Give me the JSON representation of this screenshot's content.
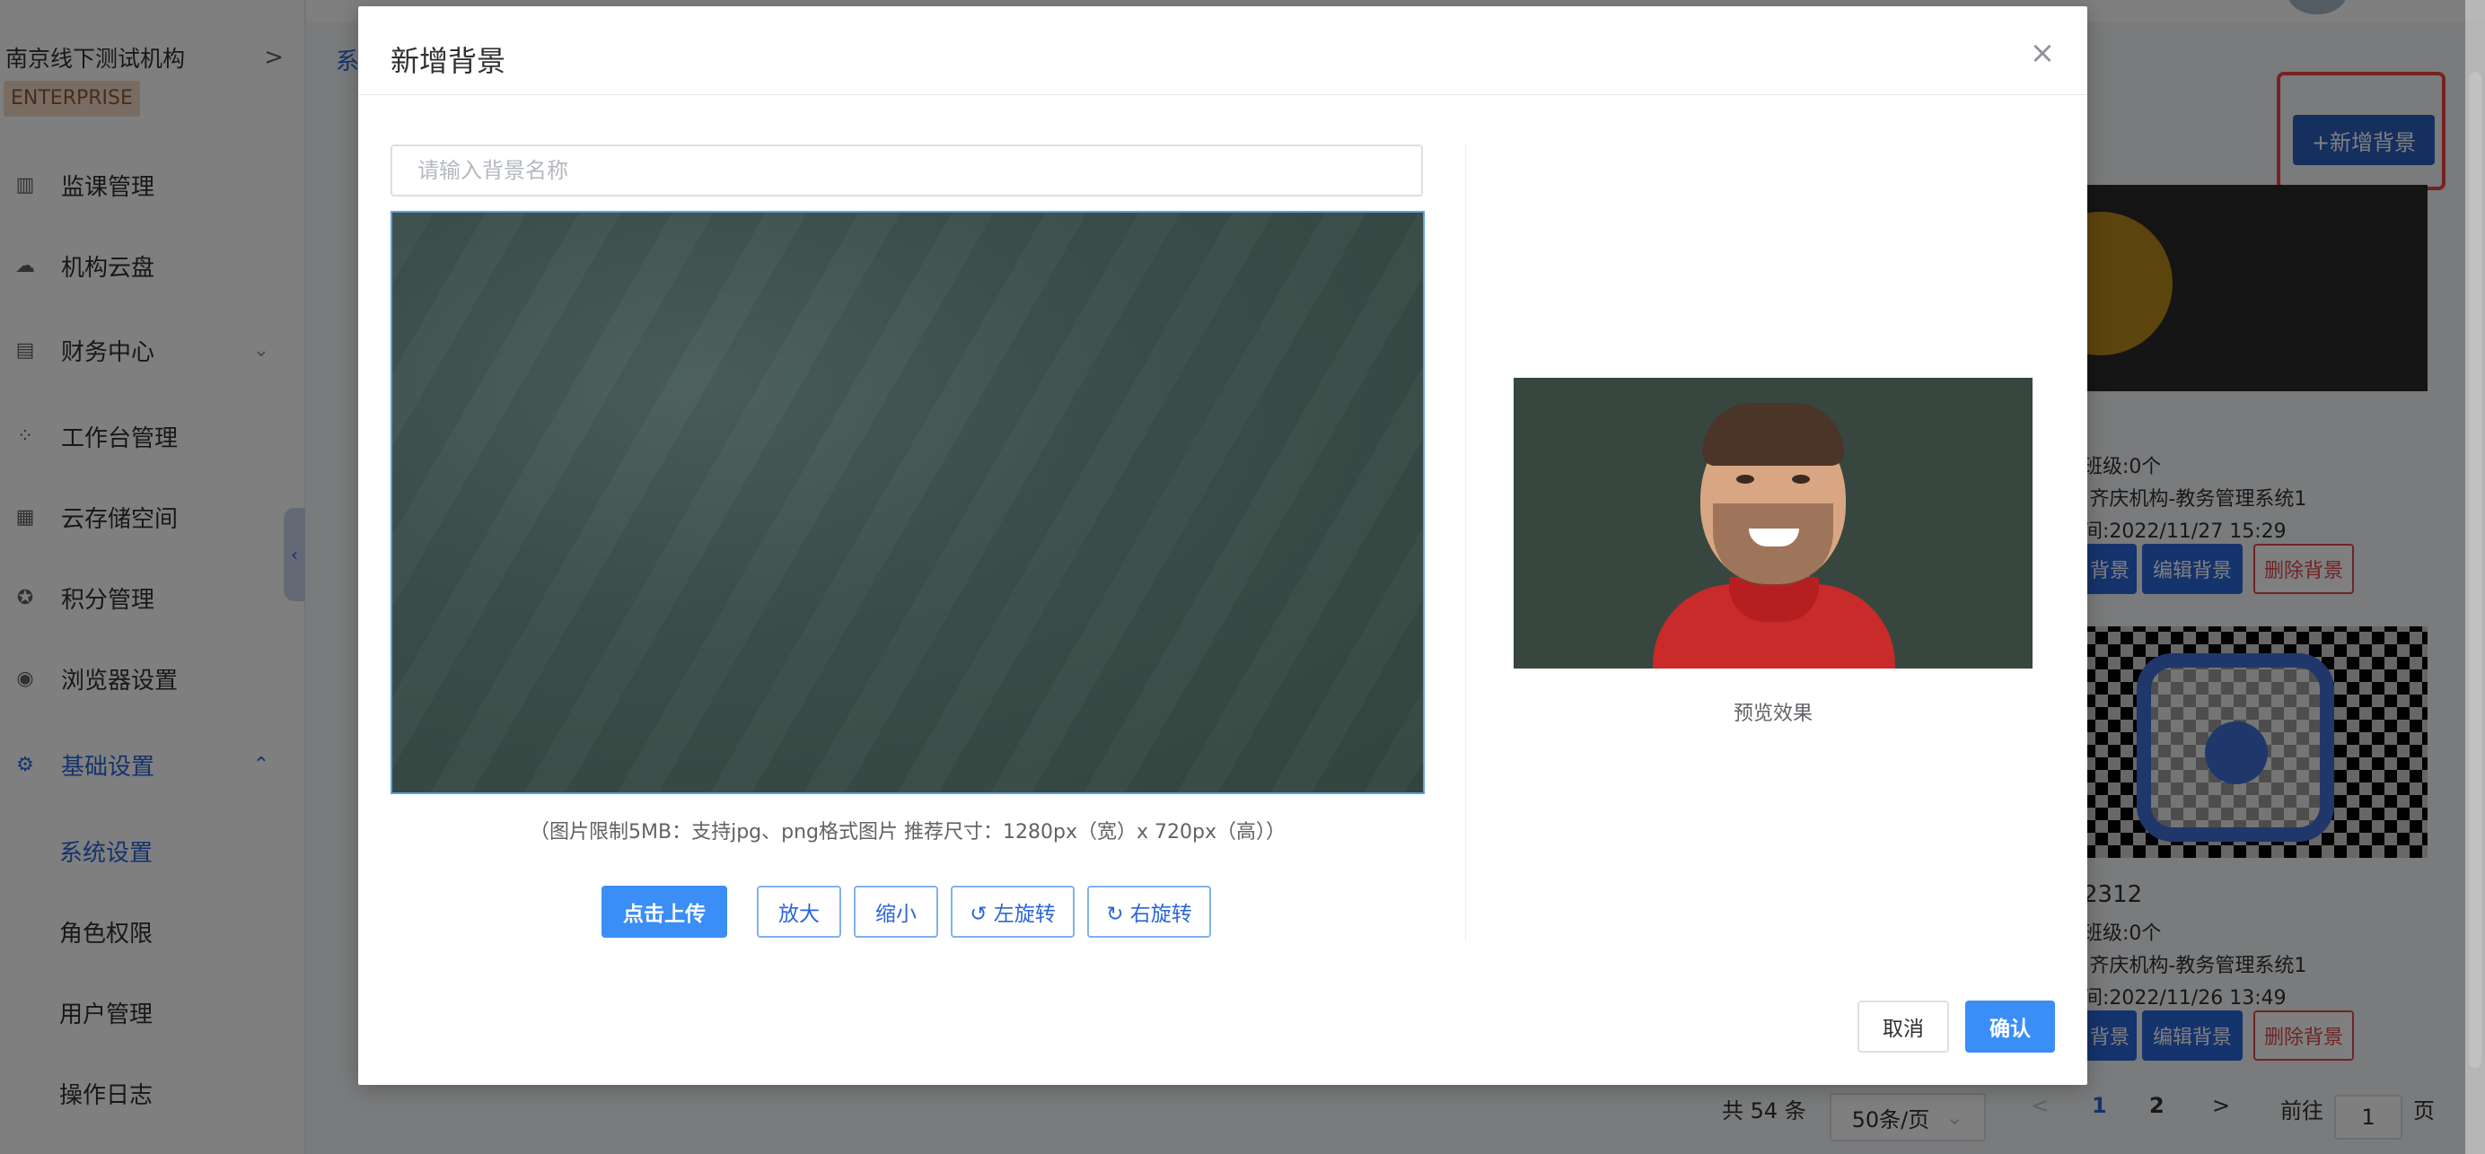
{
  "sidebar": {
    "org_name": "南京线下测试机构",
    "org_chevron": ">",
    "badge": "ENTERPRISE",
    "items": [
      {
        "label": "监课管理"
      },
      {
        "label": "机构云盘"
      },
      {
        "label": "财务中心"
      },
      {
        "label": "工作台管理"
      },
      {
        "label": "云存储空间"
      },
      {
        "label": "积分管理"
      },
      {
        "label": "浏览器设置"
      },
      {
        "label": "基础设置"
      }
    ],
    "sub_items": [
      {
        "label": "系统设置"
      },
      {
        "label": "角色权限"
      },
      {
        "label": "用户管理"
      },
      {
        "label": "操作日志"
      }
    ]
  },
  "main": {
    "breadcrumb_stub": "系",
    "add_background_label": "+新增背景",
    "cards": [
      {
        "class_count": "班级:0个",
        "org_line": ":齐庆机构-教务管理系统1",
        "time_line": "间:2022/11/27 15:29",
        "use_label": "背景",
        "edit_label": "编辑背景",
        "delete_label": "删除背景"
      },
      {
        "title_stub": "2312",
        "class_count": "班级:0个",
        "org_line": ":齐庆机构-教务管理系统1",
        "time_line": "间:2022/11/26 13:49",
        "use_label": "背景",
        "edit_label": "编辑背景",
        "delete_label": "删除背景"
      }
    ],
    "pagination": {
      "total": "共 54 条",
      "page_size": "50条/页",
      "prev": "<",
      "pages": [
        "1",
        "2"
      ],
      "next": ">",
      "goto_label": "前往",
      "goto_value": "1",
      "page_suffix": "页"
    }
  },
  "dialog": {
    "title": "新增背景",
    "close_glyph": "×",
    "name_placeholder": "请输入背景名称",
    "name_value": "",
    "hint": "（图片限制5MB：支持jpg、png格式图片 推荐尺寸：1280px（宽）x 720px（高））",
    "buttons": {
      "upload": "点击上传",
      "zoom_in": "放大",
      "zoom_out": "缩小",
      "rotate_left": "↺ 左旋转",
      "rotate_right": "↻ 右旋转"
    },
    "preview_label": "预览效果",
    "cancel": "取消",
    "confirm": "确认"
  },
  "colors": {
    "primary": "#3a8ef6",
    "accent_blue": "#2b66d9",
    "danger": "#e04848",
    "highlight": "#ef4444"
  }
}
